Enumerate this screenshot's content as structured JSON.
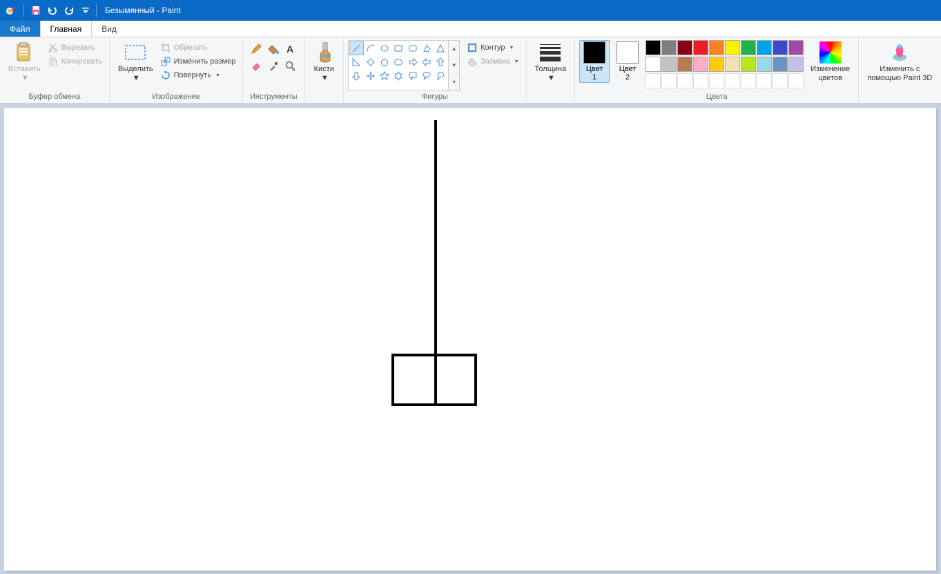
{
  "title": "Безымянный - Paint",
  "tabs": {
    "file": "Файл",
    "home": "Главная",
    "view": "Вид"
  },
  "groups": {
    "clipboard": {
      "label": "Буфер обмена",
      "paste": "Вставить",
      "cut": "Вырезать",
      "copy": "Копировать"
    },
    "image": {
      "label": "Изображение",
      "select": "Выделить",
      "crop": "Обрезать",
      "resize": "Изменить размер",
      "rotate": "Повернуть"
    },
    "tools": {
      "label": "Инструменты"
    },
    "brushes": {
      "label": "Кисти"
    },
    "shapes": {
      "label": "Фигуры",
      "outline": "Контур",
      "fill": "Заливка"
    },
    "thickness": {
      "label": "Толщина"
    },
    "colors": {
      "label": "Цвета",
      "c1": "Цвет\n1",
      "c2": "Цвет\n2",
      "edit": "Изменение\nцветов"
    },
    "p3d": {
      "label": "Изменить с\nпомощью Paint 3D"
    }
  },
  "palette_row1": [
    "#000000",
    "#7f7f7f",
    "#880015",
    "#ed1c24",
    "#ff7f27",
    "#fff200",
    "#22b14c",
    "#00a2e8",
    "#3f48cc",
    "#a349a4"
  ],
  "palette_row2": [
    "#ffffff",
    "#c3c3c3",
    "#b97a57",
    "#ffaec9",
    "#ffc90e",
    "#efe4b0",
    "#b5e61d",
    "#99d9ea",
    "#7092be",
    "#c8bfe7"
  ],
  "color1": "#000000",
  "color2": "#ffffff"
}
